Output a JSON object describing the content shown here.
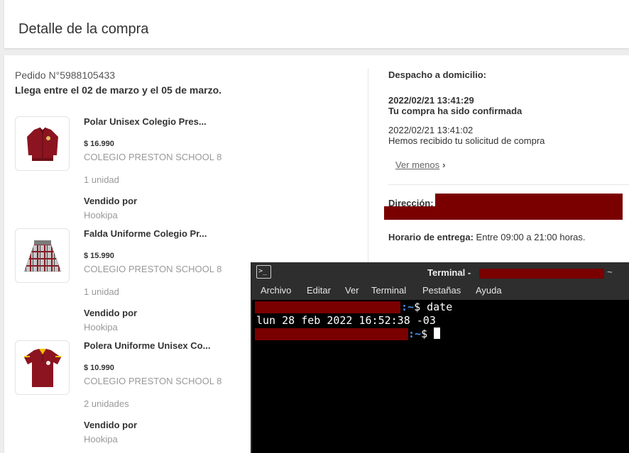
{
  "page": {
    "title": "Detalle de la compra"
  },
  "order": {
    "number": "Pedido N°5988105433",
    "eta": "Llega entre el 02 de marzo y el 05 de marzo."
  },
  "items": [
    {
      "title": "Polar Unisex Colegio Pres...",
      "price": "$ 16.990",
      "school": "COLEGIO PRESTON SCHOOL 8",
      "qty": "1 unidad",
      "sold_by_label": "Vendido por",
      "seller": "Hookipa"
    },
    {
      "title": "Falda Uniforme Colegio Pr...",
      "price": "$ 15.990",
      "school": "COLEGIO PRESTON SCHOOL 8",
      "qty": "1 unidad",
      "sold_by_label": "Vendido por",
      "seller": "Hookipa"
    },
    {
      "title": "Polera Uniforme Unisex Co...",
      "price": "$ 10.990",
      "school": "COLEGIO PRESTON SCHOOL 8",
      "qty": "2 unidades",
      "sold_by_label": "Vendido por",
      "seller": "Hookipa"
    }
  ],
  "shipping": {
    "title": "Despacho a domicilio:",
    "events": [
      {
        "date": "2022/02/21 13:41:29",
        "desc": "Tu compra ha sido confirmada"
      },
      {
        "date": "2022/02/21 13:41:02",
        "desc": "Hemos recibido tu solicitud de compra"
      }
    ],
    "see_less": "Ver menos",
    "address_label": "Dirección:",
    "hours_label": "Horario de entrega:",
    "hours_value": "Entre 09:00 a 21:00 horas."
  },
  "terminal": {
    "title": "Terminal -",
    "title_suffix": "~",
    "menu": [
      "Archivo",
      "Editar",
      "Ver",
      "Terminal",
      "Pestañas",
      "Ayuda"
    ],
    "prompt_tail": ":~",
    "prompt_symbol": "$",
    "command": "date",
    "output": "lun 28 feb 2022 16:52:38 -03"
  },
  "colors": {
    "redaction": "#7a0000",
    "prompt_blue": "#4a8ee6",
    "terminal_bg": "#000000",
    "titlebar_bg": "#2e2e2e"
  }
}
